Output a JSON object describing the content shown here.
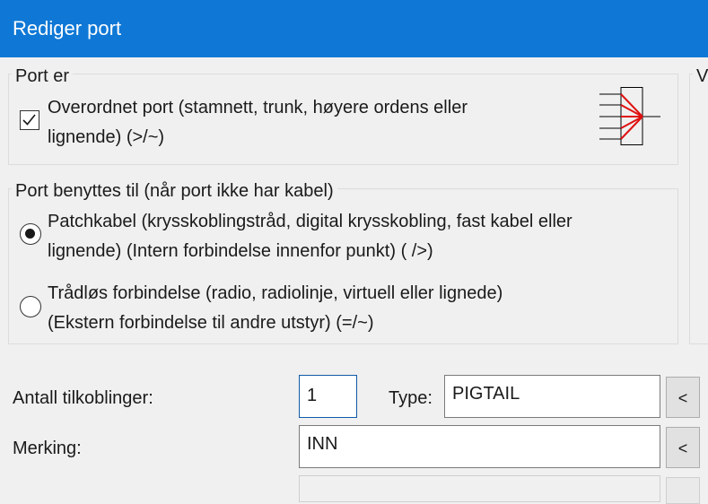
{
  "window": {
    "title": "Rediger port"
  },
  "port_is_group": {
    "legend": "Port er",
    "parent_port": {
      "checked": true,
      "line1": "Overordnet port (stamnett, trunk, høyere ordens eller",
      "line2": "lignende) (>/~)"
    },
    "icon": "port-multiplex-icon"
  },
  "port_used_for_group": {
    "legend": "Port benyttes til (når port ikke har kabel)",
    "options": [
      {
        "selected": true,
        "line1": "Patchkabel (krysskoblingstråd, digital krysskobling, fast kabel eller",
        "line2": "lignende) (Intern forbindelse innenfor punkt) ( />)"
      },
      {
        "selected": false,
        "line1": "Trådløs forbindelse (radio, radiolinje, virtuell eller lignede)",
        "line2": "(Ekstern forbindelse til andre utstyr) (=/~)"
      }
    ]
  },
  "right_group": {
    "legend_fragment": "V"
  },
  "fields": {
    "connections_label": "Antall tilkoblinger:",
    "connections_value": "1",
    "type_label": "Type:",
    "type_value": "PIGTAIL",
    "type_button": "<",
    "marking_label": "Merking:",
    "marking_value": "INN",
    "marking_button": "<"
  },
  "colors": {
    "titlebar": "#0f78d6",
    "icon_arrow": "#e01010"
  }
}
